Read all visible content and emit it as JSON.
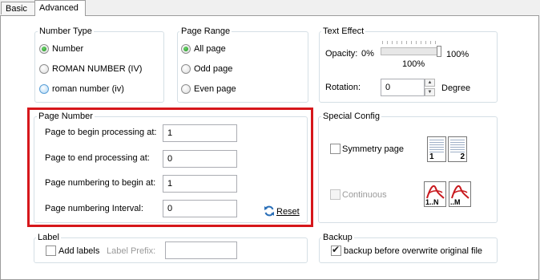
{
  "tabs": [
    {
      "label": "Basic",
      "active": false
    },
    {
      "label": "Advanced",
      "active": true
    }
  ],
  "number_type": {
    "title": "Number Type",
    "options": [
      {
        "label": "Number",
        "checked": true
      },
      {
        "label": "ROMAN NUMBER (IV)",
        "checked": false
      },
      {
        "label": "roman number (iv)",
        "checked": false
      }
    ]
  },
  "page_range": {
    "title": "Page Range",
    "options": [
      {
        "label": "All page",
        "checked": true
      },
      {
        "label": "Odd page",
        "checked": false
      },
      {
        "label": "Even page",
        "checked": false
      }
    ]
  },
  "text_effect": {
    "title": "Text Effect",
    "opacity_label": "Opacity:",
    "opacity_min": "0%",
    "opacity_max": "100%",
    "opacity_value_text": "100%",
    "opacity_value": 1.0,
    "rotation_label": "Rotation:",
    "rotation_value": "0",
    "rotation_unit": "Degree"
  },
  "page_number": {
    "title": "Page Number",
    "fields": [
      {
        "label": "Page to begin processing at:",
        "value": "1"
      },
      {
        "label": "Page to end processing at:",
        "value": "0"
      },
      {
        "label": "Page numbering to begin at:",
        "value": "1"
      },
      {
        "label": "Page numbering Interval:",
        "value": "0"
      }
    ],
    "reset_label": "Reset",
    "highlight_color": "#d6171b"
  },
  "special_config": {
    "title": "Special Config",
    "symmetry_label": "Symmetry page",
    "symmetry_checked": false,
    "continuous_label": "Continuous",
    "continuous_checked": false,
    "continuous_enabled": false,
    "symmetry_icon_nums": [
      "1",
      "2"
    ],
    "continuous_icon_nums": [
      "1..N",
      "..M"
    ]
  },
  "label_group": {
    "title": "Label",
    "add_labels": "Add labels",
    "add_labels_checked": false,
    "prefix_label": "Label Prefix:",
    "prefix_value": ""
  },
  "backup": {
    "title": "Backup",
    "label": "backup before overwrite original file",
    "checked": true
  }
}
